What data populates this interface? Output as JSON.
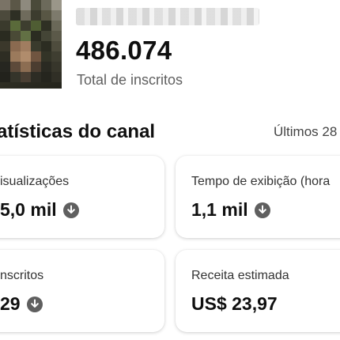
{
  "channel": {
    "subscriber_count": "486.074",
    "subscriber_label": "Total de inscritos"
  },
  "stats_section": {
    "title": "atísticas do canal",
    "period": "Últimos 28"
  },
  "cards": [
    {
      "label": "isualizações",
      "value": "5,0 mil",
      "trend": "down"
    },
    {
      "label": "Tempo de exibição (hora",
      "value": "1,1 mil",
      "trend": "down"
    },
    {
      "label": "nscritos",
      "value": "29",
      "trend": "down"
    },
    {
      "label": "Receita estimada",
      "value": "US$ 23,97",
      "trend": "none"
    }
  ],
  "icons": {
    "trend_down": "arrow-down-circle-icon"
  },
  "colors": {
    "text_primary": "#0f0f0f",
    "text_secondary": "#606060",
    "icon_gray": "#5f5f5f"
  }
}
